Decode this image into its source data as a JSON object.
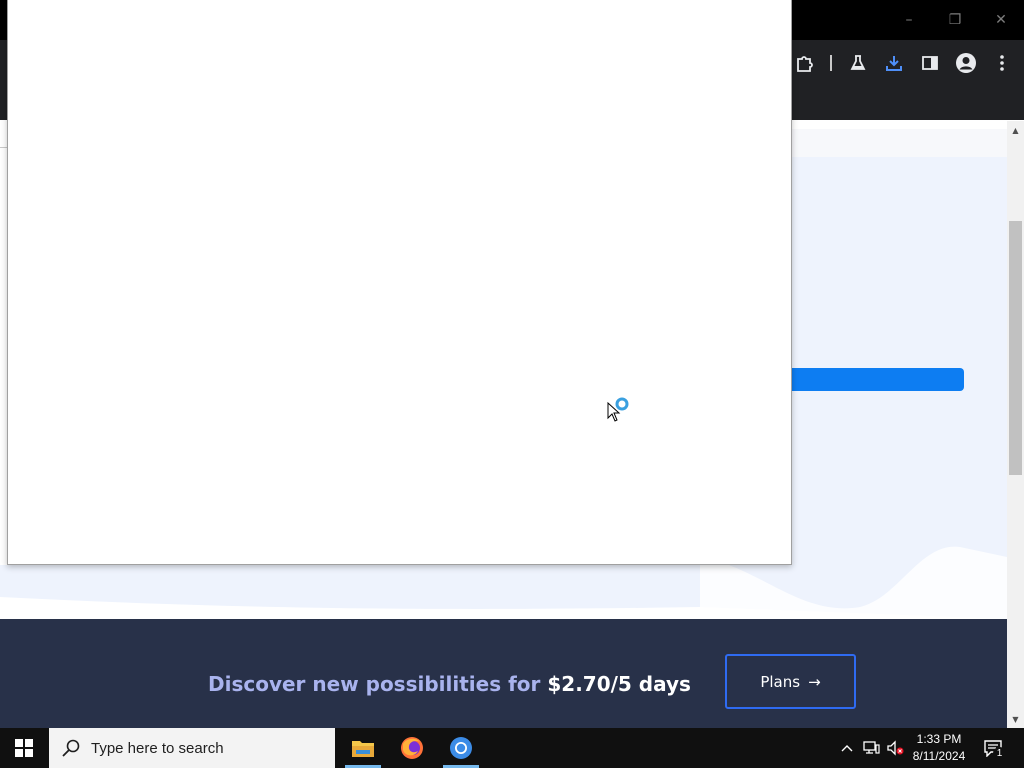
{
  "window": {
    "minimize_symbol": "–",
    "restore_symbol": "❐",
    "close_symbol": "✕"
  },
  "toolbar": {
    "icons": [
      "extensions-icon",
      "labs-flask-icon",
      "download-icon",
      "side-panel-icon",
      "profile-avatar-icon",
      "more-menu-icon"
    ]
  },
  "page": {
    "promo": {
      "text_lead": "Discover new possibilities for ",
      "text_price": "$2.70/5 days",
      "plans_button": "Plans",
      "plans_arrow": "→"
    }
  },
  "scrollbar": {
    "up_arrow": "▲",
    "down_arrow": "▼"
  },
  "taskbar": {
    "search_placeholder": "Type here to search",
    "apps": [
      "file-explorer-icon",
      "firefox-icon",
      "chrome-icon"
    ],
    "clock_time": "1:33 PM",
    "clock_date": "8/11/2024",
    "notification_count": "1"
  },
  "colors": {
    "titlebar": "#000000",
    "toolbar": "#202124",
    "hero_bg": "#eef3fd",
    "accent_blue": "#0d7df2",
    "promo_bg": "#283149",
    "promo_text": "#a9b3ee",
    "plans_border": "#2f6bf2",
    "taskbar": "#101010"
  }
}
